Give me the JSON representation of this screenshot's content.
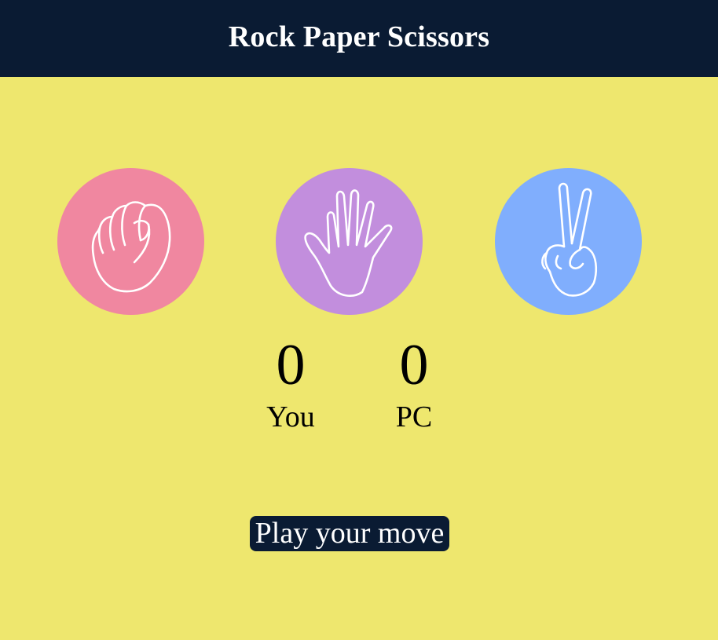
{
  "header": {
    "title": "Rock Paper Scissors"
  },
  "choices": [
    {
      "id": "rock",
      "icon": "rock-fist-icon",
      "color": "#F087A0"
    },
    {
      "id": "paper",
      "icon": "paper-hand-icon",
      "color": "#C28EDD"
    },
    {
      "id": "scissors",
      "icon": "scissors-hand-icon",
      "color": "#80AEFD"
    }
  ],
  "scoreboard": {
    "user": {
      "score": "0",
      "label": "You"
    },
    "computer": {
      "score": "0",
      "label": "PC"
    }
  },
  "message": {
    "text": "Play your move",
    "background": "#0A1B33"
  },
  "theme": {
    "background": "#EEE76E",
    "header_background": "#0A1B33"
  }
}
